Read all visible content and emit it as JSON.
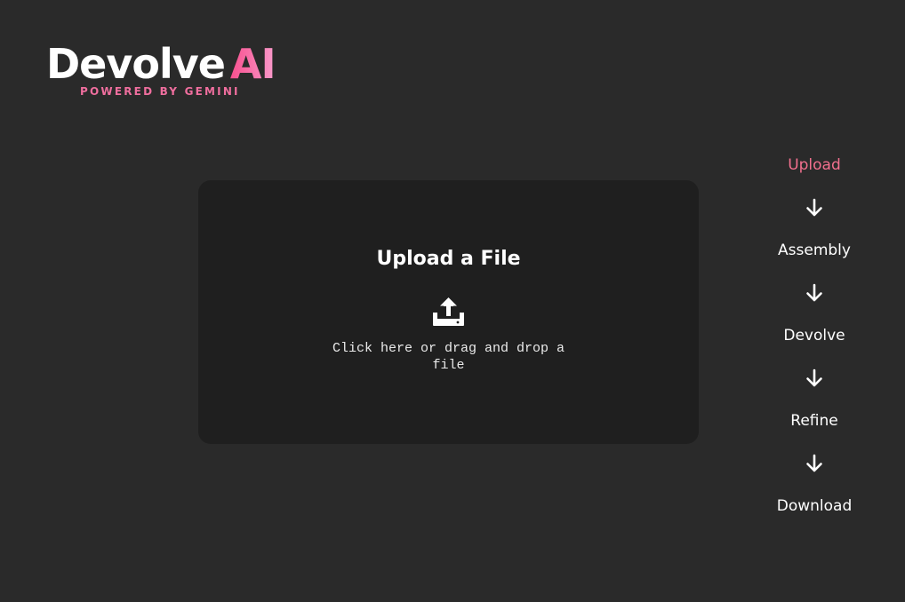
{
  "logo": {
    "word": "Devolve",
    "ai": "AI",
    "subtitle": "POWERED BY GEMINI"
  },
  "upload": {
    "title": "Upload a File",
    "hint": "Click here or drag and drop a file",
    "icon": "upload-tray-icon"
  },
  "steps": [
    {
      "label": "Upload",
      "active": true
    },
    {
      "label": "Assembly",
      "active": false
    },
    {
      "label": "Devolve",
      "active": false
    },
    {
      "label": "Refine",
      "active": false
    },
    {
      "label": "Download",
      "active": false
    }
  ],
  "colors": {
    "background": "#2a2a2a",
    "panel": "#1f1f1f",
    "accent": "#f2708e"
  }
}
